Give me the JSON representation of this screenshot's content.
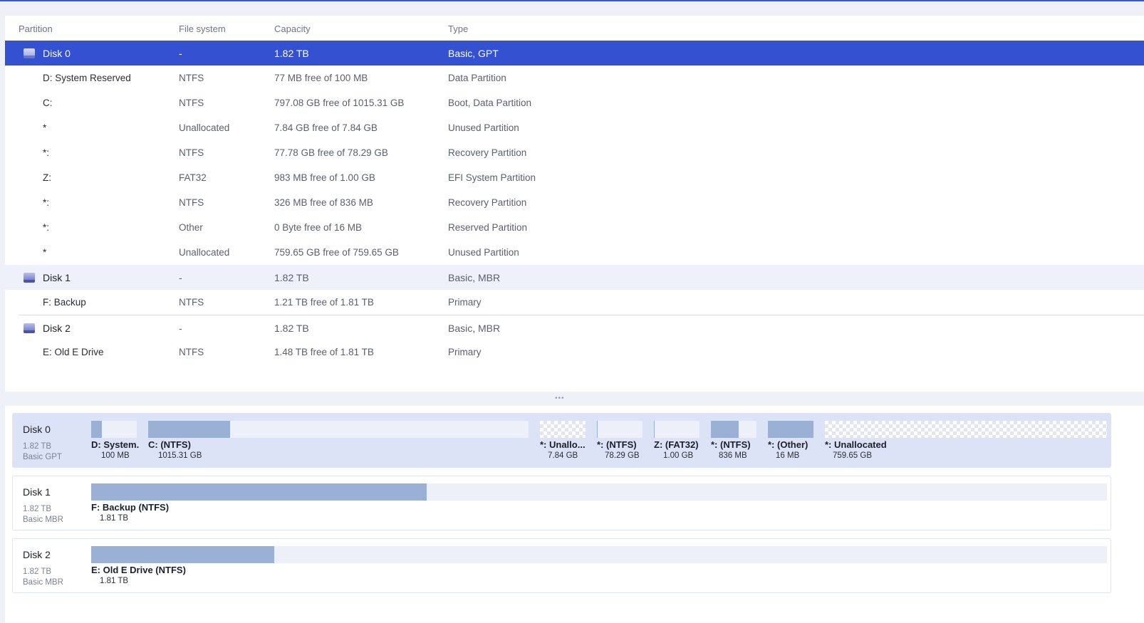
{
  "columns": {
    "partition": "Partition",
    "file_system": "File system",
    "capacity": "Capacity",
    "type": "Type"
  },
  "rows": [
    {
      "name": "Disk 0",
      "fs": "-",
      "capacity": "1.82 TB",
      "type": "Basic, GPT"
    },
    {
      "name": "D: System Reserved",
      "fs": "NTFS",
      "capacity": "77 MB free of 100 MB",
      "type": "Data Partition"
    },
    {
      "name": "C:",
      "fs": "NTFS",
      "capacity": "797.08 GB free of 1015.31 GB",
      "type": "Boot, Data Partition"
    },
    {
      "name": "*",
      "fs": "Unallocated",
      "capacity": "7.84 GB free of 7.84 GB",
      "type": "Unused Partition"
    },
    {
      "name": "*:",
      "fs": "NTFS",
      "capacity": "77.78 GB free of 78.29 GB",
      "type": "Recovery Partition"
    },
    {
      "name": "Z:",
      "fs": "FAT32",
      "capacity": "983 MB free of 1.00 GB",
      "type": "EFI System Partition"
    },
    {
      "name": "*:",
      "fs": "NTFS",
      "capacity": "326 MB free of 836 MB",
      "type": "Recovery Partition"
    },
    {
      "name": "*:",
      "fs": "Other",
      "capacity": "0 Byte free of 16 MB",
      "type": "Reserved Partition"
    },
    {
      "name": "*",
      "fs": "Unallocated",
      "capacity": "759.65 GB free of 759.65 GB",
      "type": "Unused Partition"
    },
    {
      "name": "Disk 1",
      "fs": "-",
      "capacity": "1.82 TB",
      "type": "Basic, MBR"
    },
    {
      "name": "F: Backup",
      "fs": "NTFS",
      "capacity": "1.21 TB free of 1.81 TB",
      "type": "Primary"
    },
    {
      "name": "Disk 2",
      "fs": "-",
      "capacity": "1.82 TB",
      "type": "Basic, MBR"
    },
    {
      "name": "E: Old E Drive",
      "fs": "NTFS",
      "capacity": "1.48 TB free of 1.81 TB",
      "type": "Primary"
    }
  ],
  "disk_map": [
    {
      "name": "Disk 0",
      "size": "1.82 TB",
      "type": "Basic GPT",
      "segments": [
        {
          "label": "D: System.",
          "size": "100 MB",
          "used_fraction": 0.23
        },
        {
          "label": "C: (NTFS)",
          "size": "1015.31 GB",
          "used_fraction": 0.215
        },
        {
          "label": "*: Unallo...",
          "size": "7.84 GB",
          "used_fraction": 0
        },
        {
          "label": "*: (NTFS)",
          "size": "78.29 GB",
          "used_fraction": 0.01
        },
        {
          "label": "Z: (FAT32)",
          "size": "1.00 GB",
          "used_fraction": 0.02
        },
        {
          "label": "*: (NTFS)",
          "size": "836 MB",
          "used_fraction": 0.61
        },
        {
          "label": "*: (Other)",
          "size": "16 MB",
          "used_fraction": 1.0
        },
        {
          "label": "*: Unallocated",
          "size": "759.65 GB",
          "used_fraction": 0
        }
      ]
    },
    {
      "name": "Disk 1",
      "size": "1.82 TB",
      "type": "Basic MBR",
      "segments": [
        {
          "label": "F: Backup (NTFS)",
          "size": "1.81 TB",
          "used_fraction": 0.33
        }
      ]
    },
    {
      "name": "Disk 2",
      "size": "1.82 TB",
      "type": "Basic MBR",
      "segments": [
        {
          "label": "E: Old E Drive (NTFS)",
          "size": "1.81 TB",
          "used_fraction": 0.18
        }
      ]
    }
  ],
  "splitter_glyph": "•••"
}
